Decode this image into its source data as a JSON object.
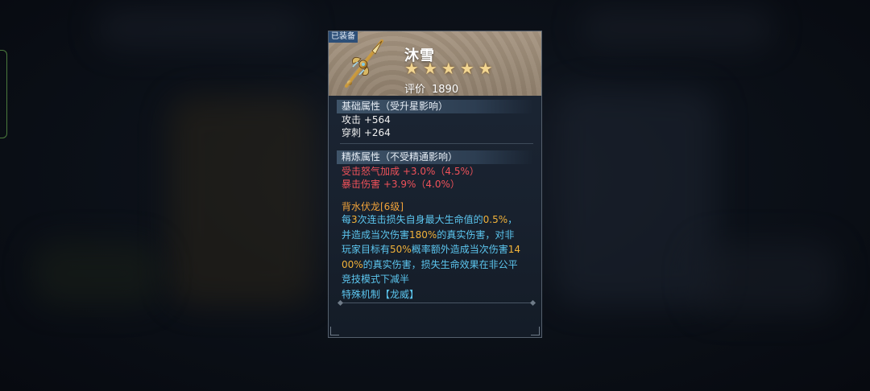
{
  "item": {
    "equipped_label": "已装备",
    "name": "沐雪",
    "stars": 5,
    "star_glyph": "★",
    "score_label": "评价",
    "score_value": "1890",
    "icon": "trident-weapon-icon"
  },
  "base_attributes": {
    "header": "基础属性（受升星影响）",
    "lines": [
      {
        "label": "攻击",
        "value": "+564"
      },
      {
        "label": "穿刺",
        "value": "+264"
      }
    ]
  },
  "refine_attributes": {
    "header": "精炼属性（不受精通影响）",
    "lines": [
      {
        "label": "受击怒气加成",
        "value": "+3.0%（4.5%）"
      },
      {
        "label": "暴击伤害",
        "value": "+3.9%（4.0%）"
      }
    ]
  },
  "skill": {
    "name": "背水伏龙[6级]",
    "desc": [
      [
        {
          "t": "每",
          "c": "blue"
        },
        {
          "t": "3",
          "c": "hl"
        },
        {
          "t": "次连击损失自身最大生命值的",
          "c": "blue"
        },
        {
          "t": "0.5%",
          "c": "hl"
        },
        {
          "t": "，",
          "c": "blue"
        }
      ],
      [
        {
          "t": "并造成当次伤害",
          "c": "blue"
        },
        {
          "t": "180%",
          "c": "hl"
        },
        {
          "t": "的真实伤害，对非",
          "c": "blue"
        }
      ],
      [
        {
          "t": "玩家目标有",
          "c": "blue"
        },
        {
          "t": "50%",
          "c": "hl"
        },
        {
          "t": "概率额外造成当次伤害",
          "c": "blue"
        },
        {
          "t": "14",
          "c": "hl"
        }
      ],
      [
        {
          "t": "00%",
          "c": "hl"
        },
        {
          "t": "的真实伤害，损失生命效果在非公平",
          "c": "blue"
        }
      ],
      [
        {
          "t": "竞技模式下减半",
          "c": "blue"
        }
      ],
      [
        {
          "t": "特殊机制【龙威】",
          "c": "blue"
        }
      ]
    ]
  },
  "colors": {
    "section_text": "#e6edf5",
    "red_stat": "#f0525a",
    "skill_name": "#f1a33a",
    "skill_text": "#5cc6ef",
    "highlight": "#f1b23a"
  }
}
